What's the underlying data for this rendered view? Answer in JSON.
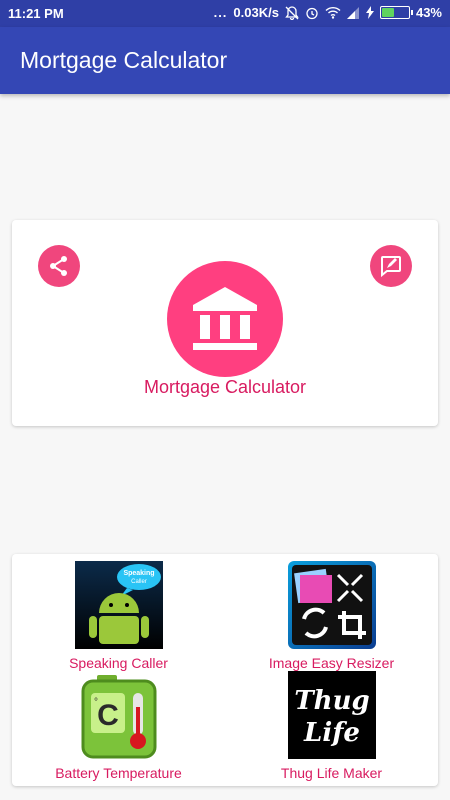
{
  "status_bar": {
    "time": "11:21 PM",
    "dots": "...",
    "speed": "0.03K/s",
    "battery": "43%",
    "battery_level": 0.43
  },
  "app_bar": {
    "title": "Mortgage Calculator"
  },
  "main_card": {
    "caption": "Mortgage Calculator",
    "share_icon": "share-icon",
    "edit_icon": "edit-icon",
    "main_icon": "bank-icon"
  },
  "apps": [
    {
      "label": "Speaking Caller",
      "icon_text": "Speaking Caller"
    },
    {
      "label": "Image Easy Resizer"
    },
    {
      "label": "Battery Temperature",
      "icon_text": "C"
    },
    {
      "label": "Thug Life Maker",
      "icon_text": "Thug Life"
    }
  ],
  "colors": {
    "primary": "#3447b5",
    "accent": "#ff3f80",
    "label": "#d81b60"
  }
}
